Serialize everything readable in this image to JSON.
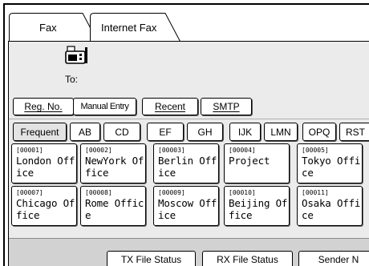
{
  "tabs": [
    {
      "label": "Fax"
    },
    {
      "label": "Internet Fax"
    }
  ],
  "destination": {
    "to_label": "To:"
  },
  "buttons": {
    "reg_no": "Reg. No.",
    "manual_entry": "Manual Entry",
    "recent": "Recent",
    "smtp": "SMTP"
  },
  "index_tabs": [
    "Frequent",
    "AB",
    "CD",
    "EF",
    "GH",
    "IJK",
    "LMN",
    "OPQ",
    "RST"
  ],
  "entries": [
    {
      "num": "[00001]",
      "l1": "London Off",
      "l2": "ice"
    },
    {
      "num": "[00002]",
      "l1": "NewYork Of",
      "l2": "fice"
    },
    {
      "num": "[00003]",
      "l1": "Berlin Off",
      "l2": "ice"
    },
    {
      "num": "[00004]",
      "l1": "Project",
      "l2": ""
    },
    {
      "num": "[00005]",
      "l1": "Tokyo Offi",
      "l2": "ce"
    },
    {
      "num": "[00007]",
      "l1": "Chicago Of",
      "l2": "fice"
    },
    {
      "num": "[00008]",
      "l1": "Rome Offic",
      "l2": "e"
    },
    {
      "num": "[00009]",
      "l1": "Moscow Off",
      "l2": "ice"
    },
    {
      "num": "[00010]",
      "l1": "Beijing Of",
      "l2": "fice"
    },
    {
      "num": "[00011]",
      "l1": "Osaka Offi",
      "l2": "ce"
    }
  ],
  "bottom_buttons": [
    "TX File Status",
    "RX File Status",
    "Sender N"
  ]
}
